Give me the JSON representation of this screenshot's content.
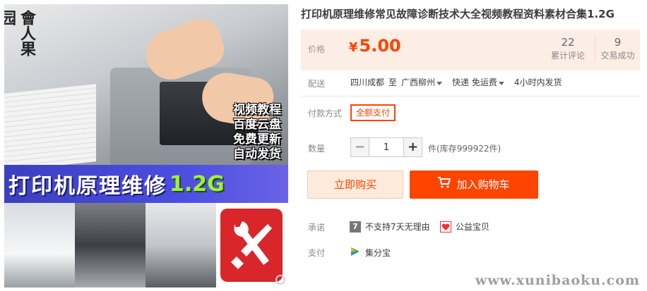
{
  "product_image": {
    "logo_text": "會人果园",
    "promo_lines": [
      "视频教程",
      "百度云盘",
      "免费更新",
      "自动发货"
    ],
    "banner_text": "打印机原理维修",
    "banner_size": "1.2G"
  },
  "title": "打印机原理维修常见故障诊断技术大全视频教程资料素材合集1.2G",
  "price": {
    "label": "价格",
    "currency": "¥",
    "value": "5.00"
  },
  "stats": {
    "reviews_count": "22",
    "reviews_label": "累计评论",
    "sales_count": "9",
    "sales_label": "交易成功"
  },
  "shipping": {
    "label": "配送",
    "from": "四川成都",
    "to_word": "至",
    "destination": "广西柳州",
    "method": "快递 免运费",
    "dispatch": "4小时内发货"
  },
  "payment_method": {
    "label": "付款方式",
    "option": "全额支付"
  },
  "quantity": {
    "label": "数量",
    "value": "1",
    "minus": "−",
    "plus": "+",
    "stock_text": "件(库存999922件)"
  },
  "actions": {
    "buy_now": "立即购买",
    "add_to_cart": "加入购物车"
  },
  "promise": {
    "label": "承诺",
    "items": [
      {
        "icon": "seven-day-icon",
        "badge": "7",
        "text": "不支持7天无理由"
      },
      {
        "icon": "charity-heart-icon",
        "text": "公益宝贝"
      }
    ]
  },
  "pay_service": {
    "label": "支付",
    "item": "集分宝"
  },
  "watermark": "www.xunibaoku.com",
  "colors": {
    "accent": "#ff4400",
    "price_bg": "#fdeee5",
    "buy_now_bg": "#ffeadb",
    "banner": "#4a4de0"
  }
}
